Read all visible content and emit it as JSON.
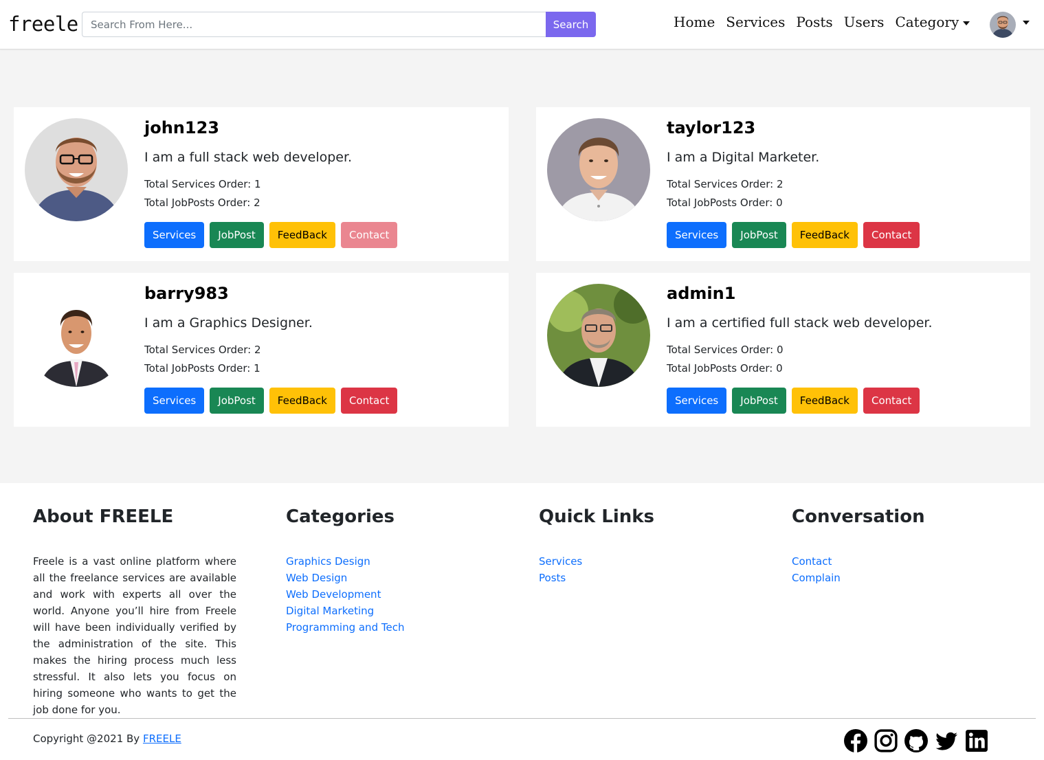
{
  "navbar": {
    "brand": "freele",
    "search_placeholder": "Search From Here...",
    "search_button": "Search",
    "links": [
      "Home",
      "Services",
      "Posts",
      "Users"
    ],
    "category_label": "Category"
  },
  "users": [
    {
      "username": "john123",
      "bio": "I am a full stack web developer.",
      "services_order": "Total Services Order: 1",
      "jobposts_order": "Total JobPosts Order: 2",
      "contact_disabled": true
    },
    {
      "username": "taylor123",
      "bio": "I am a Digital Marketer.",
      "services_order": "Total Services Order: 2",
      "jobposts_order": "Total JobPosts Order: 0",
      "contact_disabled": false
    },
    {
      "username": "barry983",
      "bio": "I am a Graphics Designer.",
      "services_order": "Total Services Order: 2",
      "jobposts_order": "Total JobPosts Order: 1",
      "contact_disabled": false
    },
    {
      "username": "admin1",
      "bio": "I am a certified full stack web developer.",
      "services_order": "Total Services Order: 0",
      "jobposts_order": "Total JobPosts Order: 0",
      "contact_disabled": false
    }
  ],
  "card_buttons": {
    "services": "Services",
    "jobpost": "JobPost",
    "feedback": "FeedBack",
    "contact": "Contact"
  },
  "footer": {
    "about": {
      "title": "About FREELE",
      "text": "Freele is a vast online platform where all the freelance services are available and work with experts all over the world. Anyone you’ll hire from Freele will have been individually verified by the administration of the site. This makes the hiring process much less stressful. It also lets you focus on hiring someone who wants to get the job done for you."
    },
    "categories": {
      "title": "Categories",
      "links": [
        "Graphics Design",
        "Web Design",
        "Web Development",
        "Digital Marketing",
        "Programming and Tech"
      ]
    },
    "quick_links": {
      "title": "Quick Links",
      "links": [
        "Services",
        "Posts"
      ]
    },
    "conversation": {
      "title": "Conversation",
      "links": [
        "Contact",
        "Complain"
      ]
    },
    "copyright_prefix": "Copyright @2021 By ",
    "copyright_link": "FREELE",
    "socials": [
      "facebook-icon",
      "instagram-icon",
      "github-icon",
      "twitter-icon",
      "linkedin-icon"
    ]
  },
  "colors": {
    "search_button": "#7b68ee",
    "primary": "#0d6efd",
    "success": "#198754",
    "warning": "#ffc107",
    "danger": "#dc3545"
  }
}
